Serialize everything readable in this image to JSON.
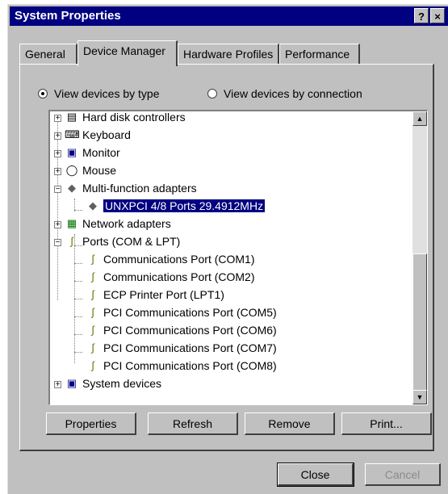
{
  "window": {
    "title": "System Properties",
    "help_button": "?",
    "close_button": "×"
  },
  "tabs": [
    {
      "label": "General"
    },
    {
      "label": "Device Manager"
    },
    {
      "label": "Hardware Profiles"
    },
    {
      "label": "Performance"
    }
  ],
  "view_options": {
    "by_type": "View devices by type",
    "by_connection": "View devices by connection",
    "selected": "by_type"
  },
  "tree": [
    {
      "label": "Hard disk controllers",
      "icon": "disk-controller-icon",
      "expander": "+"
    },
    {
      "label": "Keyboard",
      "icon": "keyboard-icon",
      "expander": "+"
    },
    {
      "label": "Monitor",
      "icon": "monitor-icon",
      "expander": "+"
    },
    {
      "label": "Mouse",
      "icon": "mouse-icon",
      "expander": "+"
    },
    {
      "label": "Multi-function adapters",
      "icon": "multifunction-adapter-icon",
      "expander": "−"
    },
    {
      "label": "UNXPCI 4/8 Ports 29.4912MHz",
      "icon": "adapter-device-icon",
      "selected": true
    },
    {
      "label": "Network adapters",
      "icon": "network-adapter-icon",
      "expander": "+"
    },
    {
      "label": "Ports (COM & LPT)",
      "icon": "port-icon",
      "expander": "−"
    },
    {
      "label": "Communications Port (COM1)",
      "icon": "port-icon"
    },
    {
      "label": "Communications Port (COM2)",
      "icon": "port-icon"
    },
    {
      "label": "ECP Printer Port (LPT1)",
      "icon": "port-icon"
    },
    {
      "label": "PCI Communications Port (COM5)",
      "icon": "port-icon"
    },
    {
      "label": "PCI Communications Port (COM6)",
      "icon": "port-icon"
    },
    {
      "label": "PCI Communications Port (COM7)",
      "icon": "port-icon"
    },
    {
      "label": "PCI Communications Port (COM8)",
      "icon": "port-icon"
    },
    {
      "label": "System devices",
      "icon": "system-devices-icon",
      "expander": "+"
    }
  ],
  "buttons": {
    "properties": "Properties",
    "refresh": "Refresh",
    "remove": "Remove",
    "print": "Print...",
    "close": "Close",
    "cancel": "Cancel"
  },
  "colors": {
    "titlebar": "#000080",
    "face": "#c0c0c0",
    "selection": "#000080"
  }
}
